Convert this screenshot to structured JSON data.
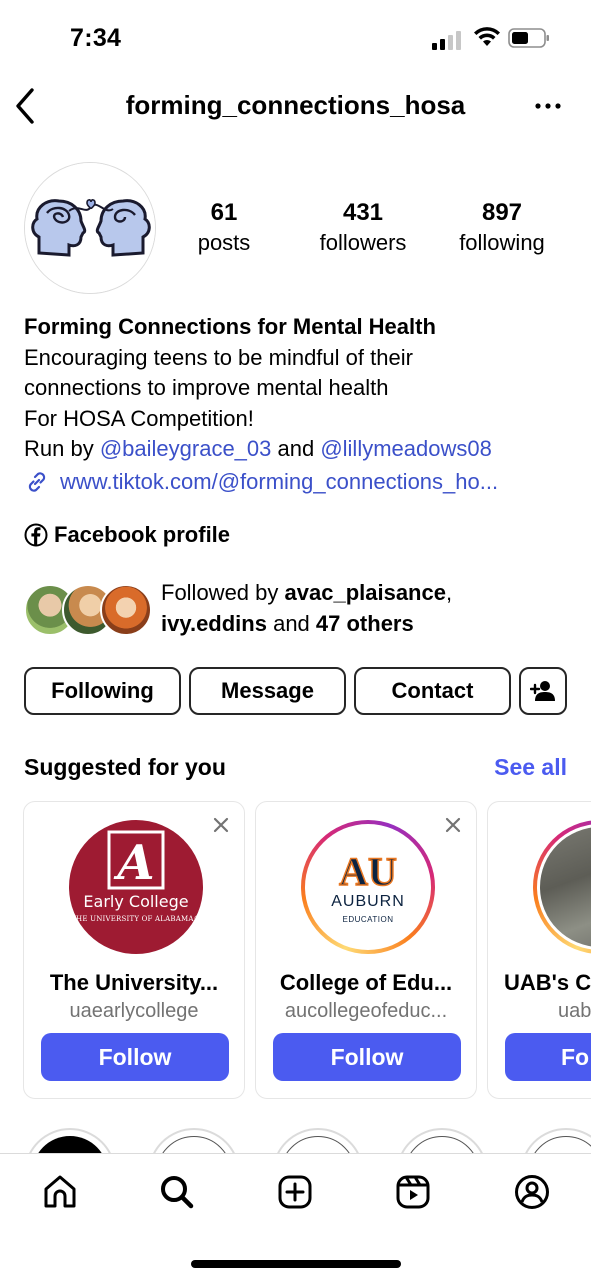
{
  "status_bar": {
    "time": "7:34"
  },
  "header": {
    "username": "forming_connections_hosa"
  },
  "stats": [
    {
      "num": "61",
      "label": "posts"
    },
    {
      "num": "431",
      "label": "followers"
    },
    {
      "num": "897",
      "label": "following"
    }
  ],
  "bio": {
    "name": "Forming Connections for Mental Health",
    "line1": "Encouraging teens to be mindful of their",
    "line2": "connections to improve mental health",
    "line3": "For HOSA Competition!",
    "run_by": "Run by ",
    "mention1": "@baileygrace_03",
    "and": " and ",
    "mention2": "@lillymeadows08",
    "link": "www.tiktok.com/@forming_connections_ho..."
  },
  "facebook": {
    "label": "Facebook profile"
  },
  "followed_by": {
    "prefix": "Followed by ",
    "user1": "avac_plaisance",
    "sep": ",",
    "user2": "ivy.eddins",
    "and": " and ",
    "others": "47 others"
  },
  "buttons": {
    "following": "Following",
    "message": "Message",
    "contact": "Contact"
  },
  "suggested": {
    "title": "Suggested for you",
    "see_all": "See all",
    "cards": [
      {
        "name": "The University...",
        "handle": "uaearlycollege",
        "follow": "Follow",
        "logo_line1": "Early College",
        "logo_line2": "THE UNIVERSITY OF ALABAMA®"
      },
      {
        "name": "College of Edu...",
        "handle": "aucollegeofeduc...",
        "follow": "Follow",
        "logo_line1": "AUBURN",
        "logo_line2": "EDUCATION"
      },
      {
        "name": "UAB's C",
        "handle": "uab",
        "follow": "Fo"
      }
    ]
  },
  "colors": {
    "accent": "#4b5bf0",
    "mention": "#3b50c9",
    "alabama_crimson": "#9e1b32",
    "auburn_navy": "#0c2340",
    "auburn_orange": "#e87722"
  },
  "tabs": [
    "home-icon",
    "search-icon",
    "create-icon",
    "reels-icon",
    "profile-icon"
  ]
}
